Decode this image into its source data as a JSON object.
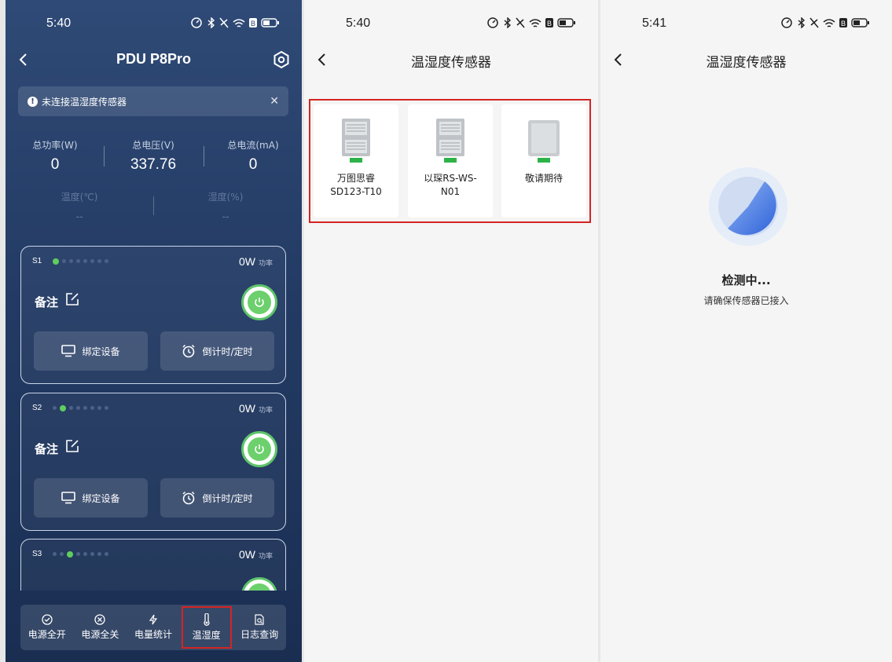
{
  "screen1": {
    "time": "5:40",
    "title": "PDU P8Pro",
    "alert": "未连接温湿度传感器",
    "stats": [
      {
        "label": "总功率(W)",
        "value": "0"
      },
      {
        "label": "总电压(V)",
        "value": "337.76"
      },
      {
        "label": "总电流(mA)",
        "value": "0"
      }
    ],
    "env": [
      {
        "label": "温度(℃)",
        "value": "--"
      },
      {
        "label": "湿度(%)",
        "value": "--"
      }
    ],
    "sockets": [
      {
        "id": "S1",
        "power": "0W",
        "power_unit": "功率",
        "note": "备注",
        "bind": "绑定设备",
        "timer": "倒计时/定时"
      },
      {
        "id": "S2",
        "power": "0W",
        "power_unit": "功率",
        "note": "备注",
        "bind": "绑定设备",
        "timer": "倒计时/定时"
      },
      {
        "id": "S3",
        "power": "0W",
        "power_unit": "功率"
      }
    ],
    "tabs": [
      {
        "label": "电源全开",
        "icon": "check-circle-icon"
      },
      {
        "label": "电源全关",
        "icon": "x-circle-icon"
      },
      {
        "label": "电量统计",
        "icon": "lightning-icon"
      },
      {
        "label": "温湿度",
        "icon": "thermometer-icon"
      },
      {
        "label": "日志查询",
        "icon": "log-search-icon"
      }
    ],
    "selected_tab": "温湿度"
  },
  "screen2": {
    "time": "5:40",
    "title": "温湿度传感器",
    "sensors": [
      {
        "name_line1": "万图思睿",
        "name_line2": "SD123-T10"
      },
      {
        "name_line1": "以琛RS-WS-",
        "name_line2": "N01"
      },
      {
        "name_line1": "敬请期待",
        "name_line2": ""
      }
    ]
  },
  "screen3": {
    "time": "5:41",
    "title": "温湿度传感器",
    "status": "检测中...",
    "hint": "请确保传感器已接入"
  },
  "colors": {
    "accent_green": "#5fce5f",
    "highlight_red": "#d42424",
    "progress_blue": "#3f74e0"
  }
}
